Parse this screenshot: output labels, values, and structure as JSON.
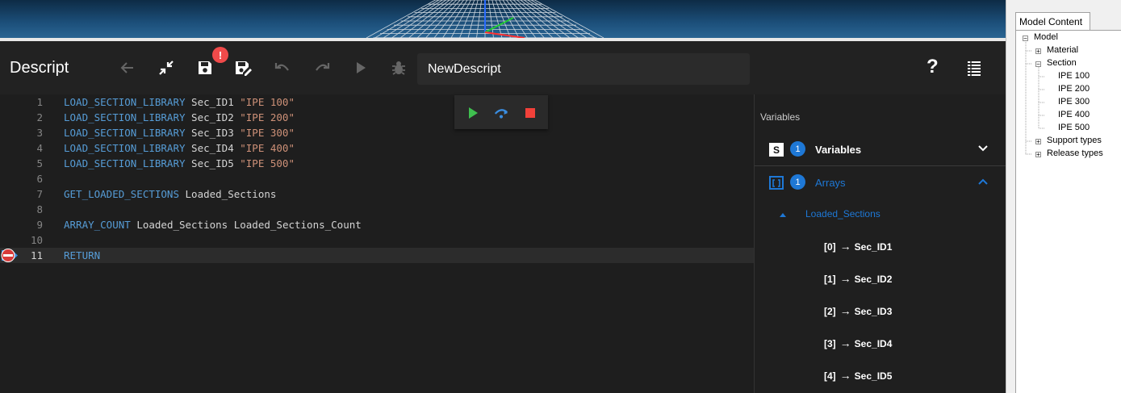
{
  "toolbar": {
    "title": "Descript",
    "save_badge": "!",
    "script_name": "NewDescript",
    "help_label": "?"
  },
  "editor": {
    "lines": [
      {
        "n": "1",
        "kw": "LOAD_SECTION_LIBRARY",
        "rest": " Sec_ID1 ",
        "str": "\"IPE 100\""
      },
      {
        "n": "2",
        "kw": "LOAD_SECTION_LIBRARY",
        "rest": " Sec_ID2 ",
        "str": "\"IPE 200\""
      },
      {
        "n": "3",
        "kw": "LOAD_SECTION_LIBRARY",
        "rest": " Sec_ID3 ",
        "str": "\"IPE 300\""
      },
      {
        "n": "4",
        "kw": "LOAD_SECTION_LIBRARY",
        "rest": " Sec_ID4 ",
        "str": "\"IPE 400\""
      },
      {
        "n": "5",
        "kw": "LOAD_SECTION_LIBRARY",
        "rest": " Sec_ID5 ",
        "str": "\"IPE 500\""
      },
      {
        "n": "6",
        "kw": "",
        "rest": "",
        "str": ""
      },
      {
        "n": "7",
        "kw": "GET_LOADED_SECTIONS",
        "rest": " Loaded_Sections",
        "str": ""
      },
      {
        "n": "8",
        "kw": "",
        "rest": "",
        "str": ""
      },
      {
        "n": "9",
        "kw": "ARRAY_COUNT",
        "rest": " Loaded_Sections Loaded_Sections_Count",
        "str": ""
      },
      {
        "n": "10",
        "kw": "",
        "rest": "",
        "str": ""
      },
      {
        "n": "11",
        "kw": "RETURN",
        "rest": "",
        "str": ""
      }
    ],
    "current_line": "11"
  },
  "variables_panel": {
    "title": "Variables",
    "variables": {
      "icon": "S",
      "count": "1",
      "label": "Variables"
    },
    "arrays": {
      "count": "1",
      "label": "Arrays",
      "array_name": "Loaded_Sections",
      "items": [
        {
          "index": "[0]",
          "value": "Sec_ID1"
        },
        {
          "index": "[1]",
          "value": "Sec_ID2"
        },
        {
          "index": "[2]",
          "value": "Sec_ID3"
        },
        {
          "index": "[3]",
          "value": "Sec_ID4"
        },
        {
          "index": "[4]",
          "value": "Sec_ID5"
        }
      ]
    }
  },
  "model_tree": {
    "tab": "Model Content",
    "root": "Model",
    "material": "Material",
    "section": "Section",
    "sections": [
      "IPE 100",
      "IPE 200",
      "IPE 300",
      "IPE 400",
      "IPE 500"
    ],
    "support_types": "Support types",
    "release_types": "Release types"
  },
  "colors": {
    "accent": "#1e78d6",
    "keyword": "#569cd6",
    "string": "#ce9178",
    "badge_red": "#f04a4a",
    "play_green": "#3fbf4f",
    "stop_red": "#f2413a"
  }
}
